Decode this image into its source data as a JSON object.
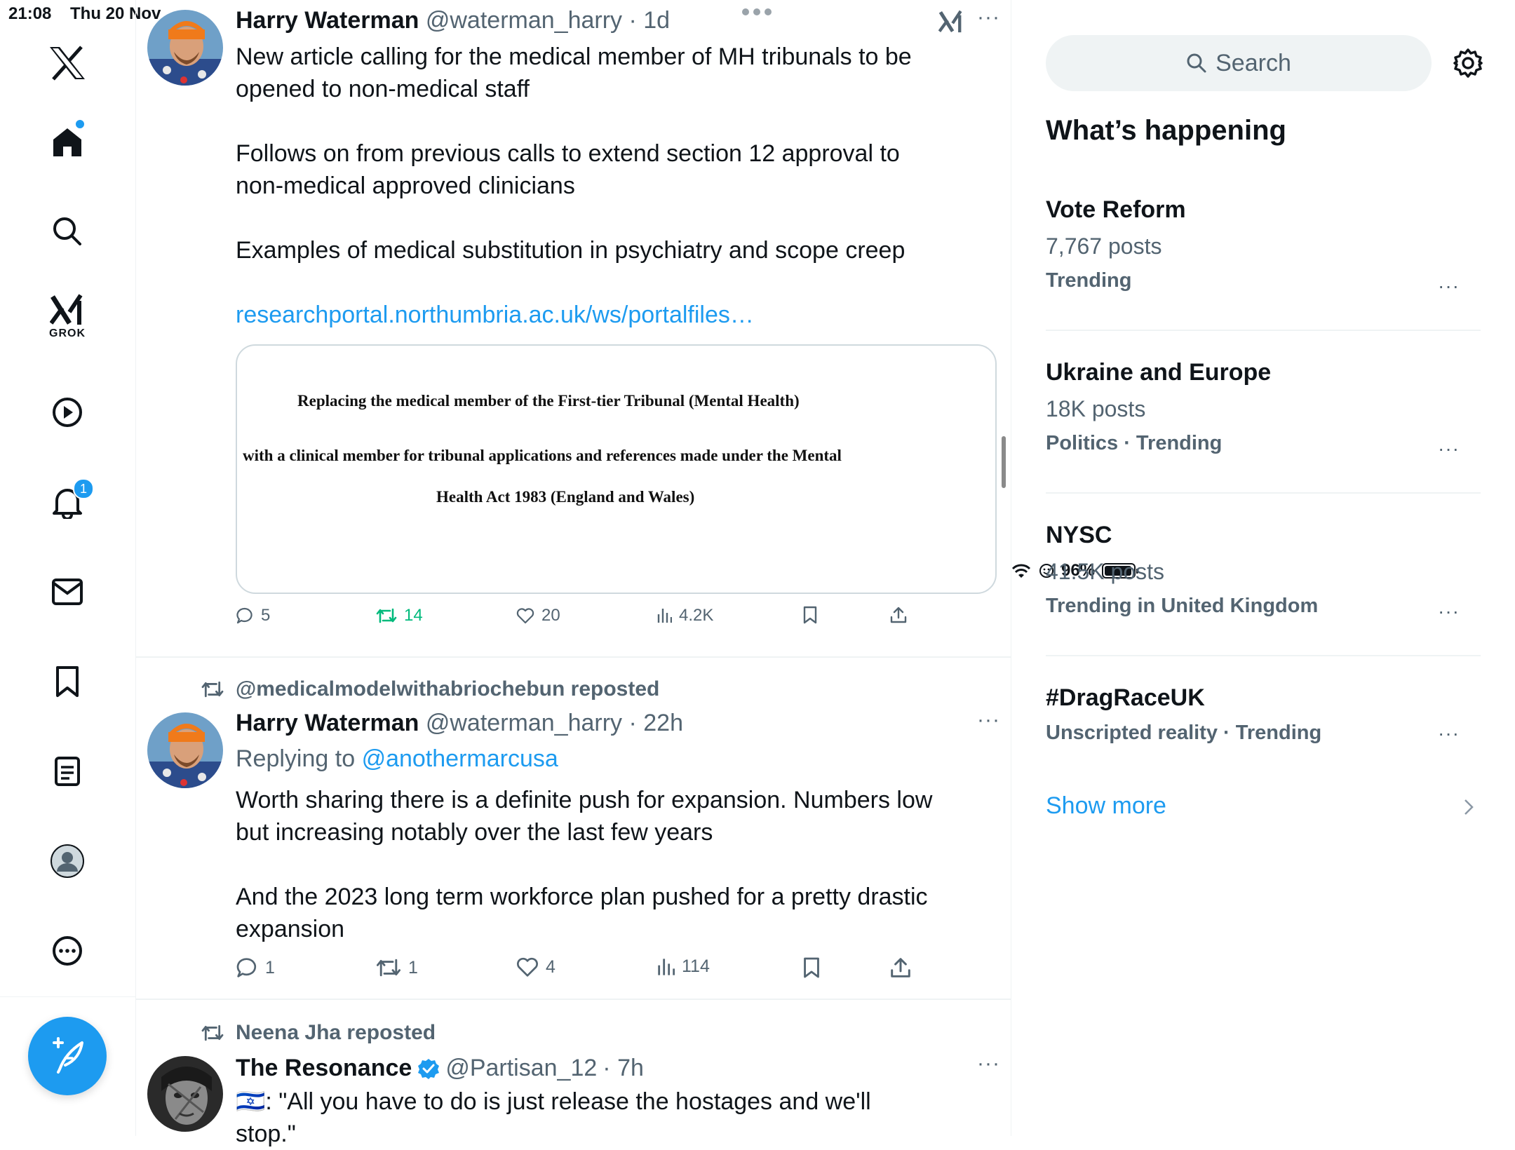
{
  "status_bar": {
    "time": "21:08",
    "date": "Thu 20 Nov",
    "battery": "96%",
    "battery_level": 0.96
  },
  "nav": {
    "items": [
      {
        "id": "logo",
        "icon": "x-logo-icon"
      },
      {
        "id": "home",
        "icon": "home-icon"
      },
      {
        "id": "explore",
        "icon": "search-icon"
      },
      {
        "id": "grok",
        "icon": "grok-icon",
        "label": "GROK"
      },
      {
        "id": "video",
        "icon": "play-icon"
      },
      {
        "id": "notifications",
        "icon": "bell-icon",
        "badge": "1"
      },
      {
        "id": "messages",
        "icon": "mail-icon"
      },
      {
        "id": "bookmarks",
        "icon": "bookmark-icon"
      },
      {
        "id": "lists",
        "icon": "list-icon"
      },
      {
        "id": "profile",
        "icon": "avatar-icon"
      },
      {
        "id": "more",
        "icon": "more-circle-icon"
      }
    ],
    "compose_icon": "compose-icon"
  },
  "feed": {
    "tweets": [
      {
        "name": "Harry Waterman",
        "handle": "@waterman_harry",
        "time": "· 1d",
        "text_paragraphs": [
          "New article calling for the medical member of MH tribunals to be opened to non-medical staff",
          "Follows on from previous calls to extend section 12 approval to non-medical approved clinicians",
          "Examples of medical substitution in psychiatry and scope creep"
        ],
        "link": "researchportal.northumbria.ac.uk/ws/portalfiles…",
        "card_lines": [
          "Replacing the medical member of the First-tier Tribunal (Mental Health)",
          "with a clinical member for tribunal applications and references made under the Mental",
          "Health Act 1983 (England and Wales)"
        ],
        "actions": {
          "replies": "5",
          "reposts": "14",
          "likes": "20",
          "views": "4.2K"
        }
      },
      {
        "reposted_by": "@medicalmodelwithabriochebun reposted",
        "name": "Harry Waterman",
        "handle": "@waterman_harry",
        "time": "· 22h",
        "replying_prefix": "Replying to",
        "replying_to": "@anothermarcusa",
        "text_paragraphs": [
          "Worth sharing there is a definite push for expansion. Numbers low but increasing notably over the last few years",
          "And the 2023 long term workforce plan pushed for a pretty drastic expansion"
        ],
        "actions": {
          "replies": "1",
          "reposts": "1",
          "likes": "4",
          "views": "114"
        }
      },
      {
        "reposted_by": "Neena Jha reposted",
        "name": "The Resonance",
        "handle": "@Partisan_12",
        "time": "· 7h",
        "verified": true,
        "text": "🇮🇱: \"All you have to do is just release the hostages and we'll stop.\""
      }
    ],
    "colors": {
      "accent": "#1d9bf0",
      "repost_active": "#00ba7c",
      "secondary": "#536471"
    }
  },
  "sidebar": {
    "search_placeholder": "Search",
    "title": "What’s happening",
    "trends": [
      {
        "title": "Vote Reform",
        "posts": "7,767 posts",
        "meta": "Trending"
      },
      {
        "title": "Ukraine and Europe",
        "posts": "18K posts",
        "meta": "Politics · Trending"
      },
      {
        "title": "NYSC",
        "posts": "41.5K posts",
        "meta": "Trending in United Kingdom"
      },
      {
        "title": "#DragRaceUK",
        "posts": "",
        "meta": "Unscripted reality · Trending"
      }
    ],
    "show_more": "Show more"
  }
}
